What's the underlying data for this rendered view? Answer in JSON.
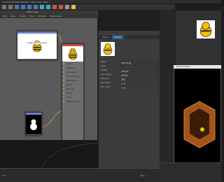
{
  "app": {
    "title": "Cinema 4D R20.026 (RC) - [bee.c4d] - Main",
    "menu": [
      "File",
      "Edit",
      "Create",
      "Modes",
      "Select",
      "Tools",
      "Mesh",
      "Snap",
      "Animate",
      "Simulate",
      "Render",
      "Sculpt",
      "Motion Tracker",
      "MoGraph",
      "Character",
      "Pipeline",
      "Plugins",
      "Script",
      "Window",
      "Help"
    ]
  },
  "node_editor": {
    "window_title": "Editor: bee",
    "menu": [
      "Edit",
      "View",
      "Create",
      "Tools",
      "Window",
      "Preferences"
    ],
    "nodes": [
      {
        "id": "image",
        "title": "Image Node (bee.png)",
        "label": "Image Node (bee.png)"
      },
      {
        "id": "material",
        "title": "Material",
        "ports": [
          "Color",
          "Diffusion",
          "Luminance",
          "Transparency",
          "Reflectance",
          "Bump",
          "Normal",
          "Alpha",
          "Glow",
          "Displacement"
        ]
      },
      {
        "id": "alpha",
        "title": "Alpha"
      }
    ]
  },
  "attributes": {
    "tabs": [
      "Basic",
      "Shader"
    ],
    "rows": [
      {
        "label": "Name",
        "value": "bee.png"
      },
      {
        "label": "Layer",
        "value": ""
      },
      {
        "label": "Shader",
        "value": "Image"
      },
      {
        "label": "Color Space",
        "value": "sRGB"
      },
      {
        "label": "Sampling",
        "value": "MIP"
      },
      {
        "label": "Blur Offset",
        "value": "0 %"
      },
      {
        "label": "Blur Scale",
        "value": "0 %"
      }
    ]
  },
  "render_window": {
    "title": "Picture Viewer"
  },
  "timeline": {
    "start": "0 F",
    "end": "90 F"
  },
  "colors": {
    "accent": "#2d5a84",
    "port": "#d6a13a",
    "bee_yellow": "#f3c200"
  }
}
